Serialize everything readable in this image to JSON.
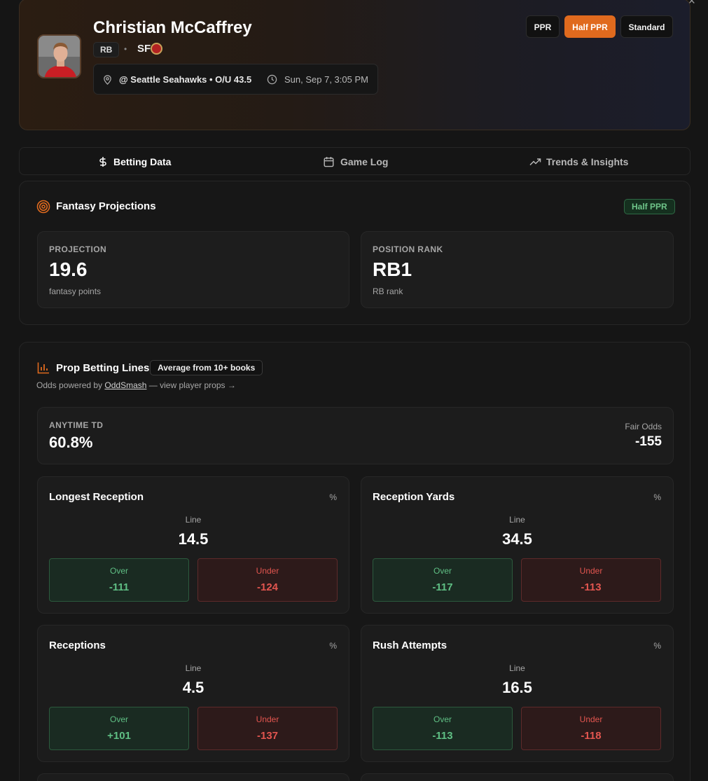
{
  "close_glyph": "×",
  "player": {
    "name": "Christian McCaffrey",
    "position": "RB",
    "separator": "•",
    "team": "SF",
    "matchup": "@ Seattle Seahawks • O/U 43.5",
    "game_time": "Sun, Sep 7, 3:05 PM"
  },
  "scoring_formats": [
    {
      "label": "PPR",
      "active": false
    },
    {
      "label": "Half PPR",
      "active": true
    },
    {
      "label": "Standard",
      "active": false
    }
  ],
  "tabs": [
    {
      "label": "Betting Data",
      "icon": "dollar-icon",
      "active": true
    },
    {
      "label": "Game Log",
      "icon": "calendar-icon",
      "active": false
    },
    {
      "label": "Trends & Insights",
      "icon": "trending-up-icon",
      "active": false
    }
  ],
  "projections": {
    "title": "Fantasy Projections",
    "format_badge": "Half PPR",
    "projection": {
      "label": "PROJECTION",
      "value": "19.6",
      "sub": "fantasy points"
    },
    "rank": {
      "label": "POSITION RANK",
      "value": "RB1",
      "sub": "RB rank"
    }
  },
  "props": {
    "title": "Prop Betting Lines",
    "books_badge": "Average from 10+ books",
    "powered_prefix": "Odds powered by",
    "powered_link": "OddSmash",
    "powered_suffix": "— view player props →",
    "anytime_td": {
      "label": "ANYTIME TD",
      "value": "60.8%",
      "fair_label": "Fair Odds",
      "fair_value": "-155"
    },
    "line_label": "Line",
    "pct_label": "%",
    "over_label": "Over",
    "under_label": "Under",
    "cards": [
      {
        "title": "Longest Reception",
        "line": "14.5",
        "over": "-111",
        "under": "-124"
      },
      {
        "title": "Reception Yards",
        "line": "34.5",
        "over": "-117",
        "under": "-113"
      },
      {
        "title": "Receptions",
        "line": "4.5",
        "over": "+101",
        "under": "-137"
      },
      {
        "title": "Rush Attempts",
        "line": "16.5",
        "over": "-113",
        "under": "-118"
      }
    ]
  },
  "colors": {
    "accent": "#e06a1e",
    "over_green": "#5fbf84",
    "under_red": "#e2554f"
  }
}
